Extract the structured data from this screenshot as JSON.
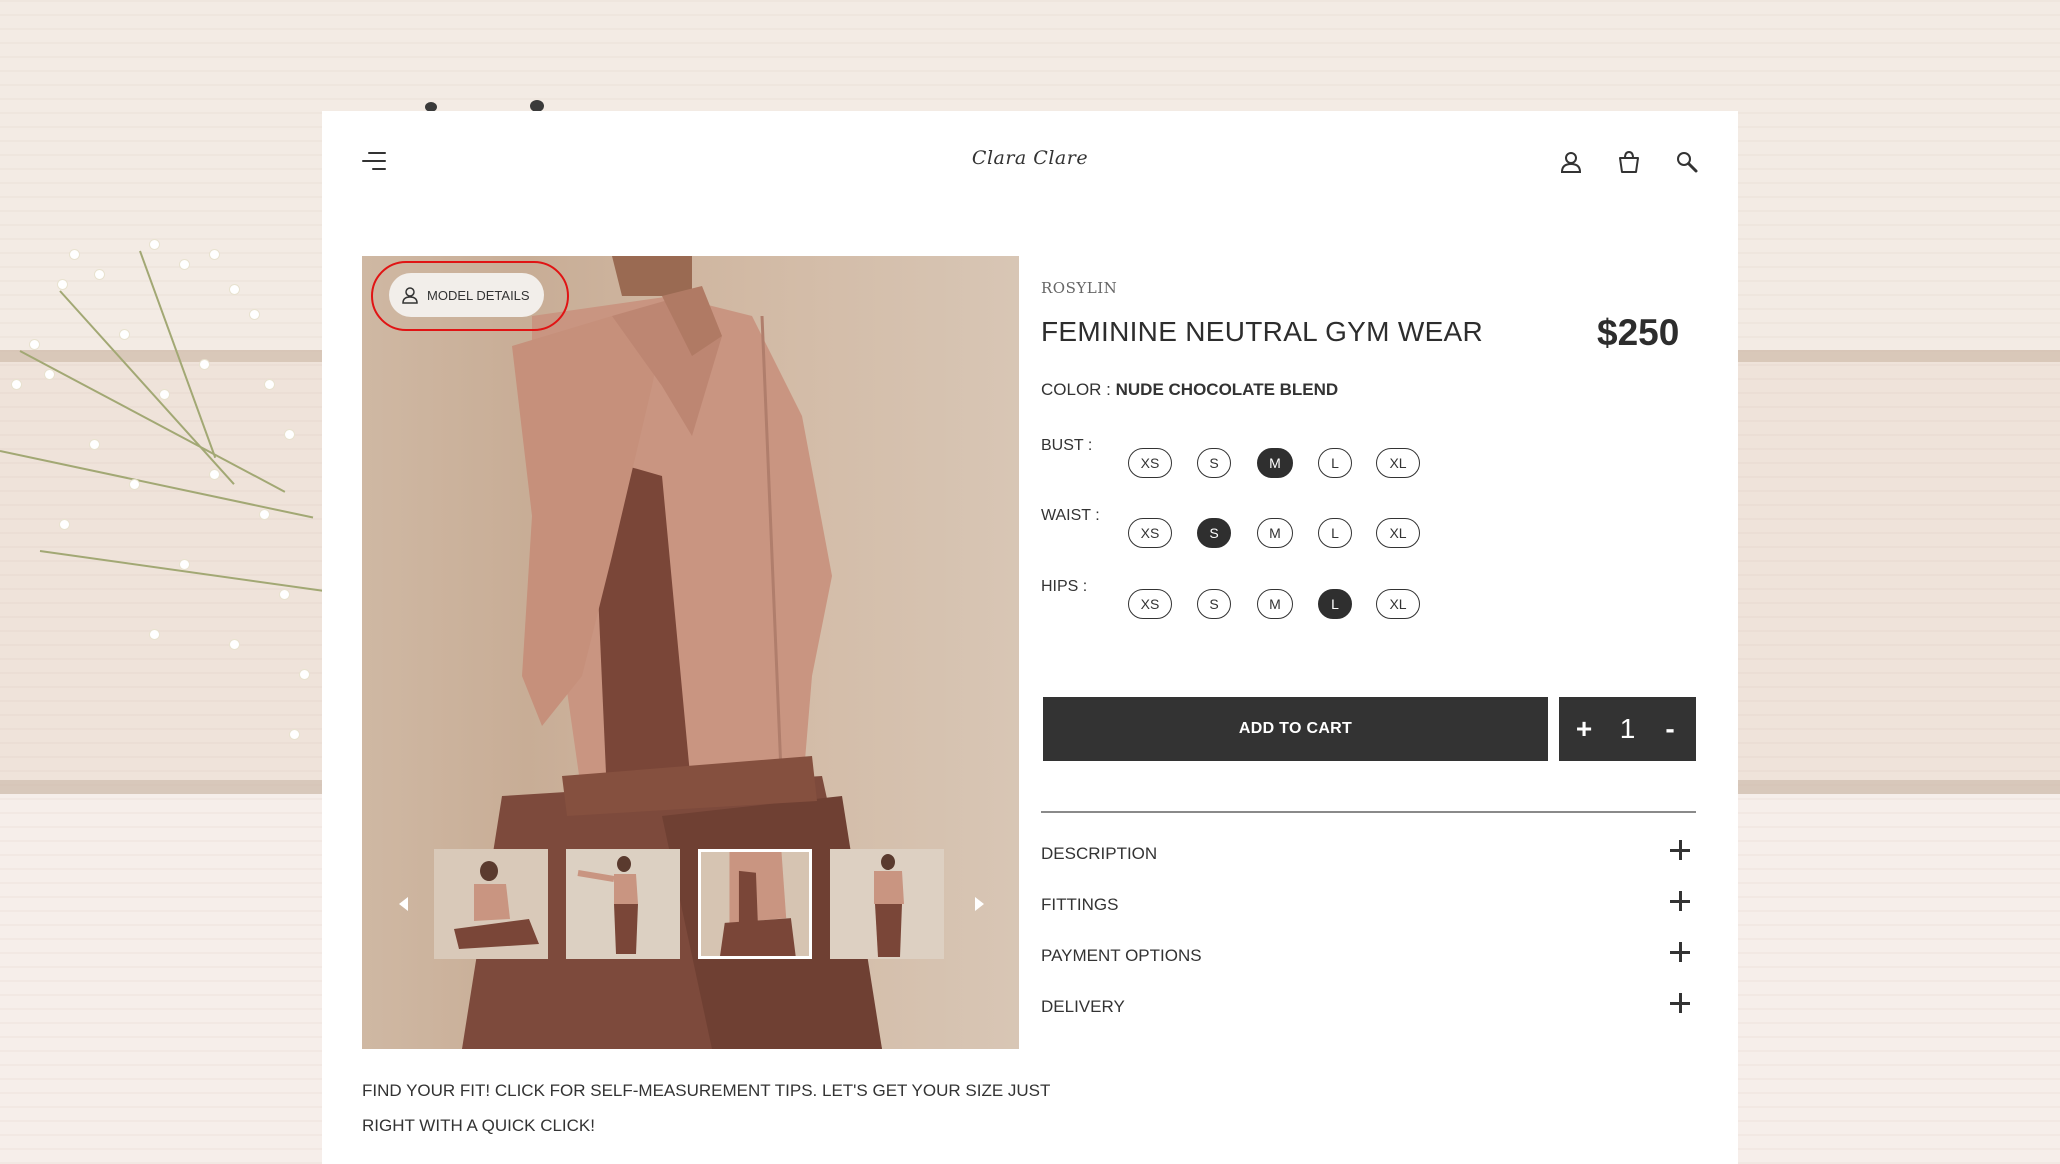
{
  "header": {
    "brand": "Clara Clare",
    "icons": [
      "menu-icon",
      "user-icon",
      "bag-icon",
      "search-icon"
    ]
  },
  "gallery": {
    "model_details_label": "MODEL DETAILS",
    "thumbnail_count": 4,
    "active_thumbnail": 3
  },
  "product": {
    "vendor": "ROSYLIN",
    "title": "FEMININE NEUTRAL GYM WEAR",
    "price": "$250",
    "color_label": "COLOR : ",
    "color_value": "NUDE CHOCOLATE BLEND"
  },
  "sizes": {
    "bust": {
      "label": "BUST :",
      "options": [
        "XS",
        "S",
        "M",
        "L",
        "XL"
      ],
      "selected": "M"
    },
    "waist": {
      "label": "WAIST :",
      "options": [
        "XS",
        "S",
        "M",
        "L",
        "XL"
      ],
      "selected": "S"
    },
    "hips": {
      "label": "HIPS :",
      "options": [
        "XS",
        "S",
        "M",
        "L",
        "XL"
      ],
      "selected": "L"
    }
  },
  "cart": {
    "add_label": "ADD TO CART",
    "plus": "+",
    "quantity": "1",
    "minus": "-"
  },
  "accordion": [
    {
      "label": "DESCRIPTION"
    },
    {
      "label": "FITTINGS"
    },
    {
      "label": "PAYMENT OPTIONS"
    },
    {
      "label": "DELIVERY"
    }
  ],
  "fit_tip": "FIND YOUR FIT! CLICK FOR SELF-MEASUREMENT TIPS. LET'S GET YOUR SIZE JUST RIGHT WITH A QUICK CLICK!",
  "colors": {
    "dark": "#333333",
    "highlight_ring": "#e01414",
    "fabric_light": "#c99581",
    "fabric_dark": "#7a4638"
  }
}
